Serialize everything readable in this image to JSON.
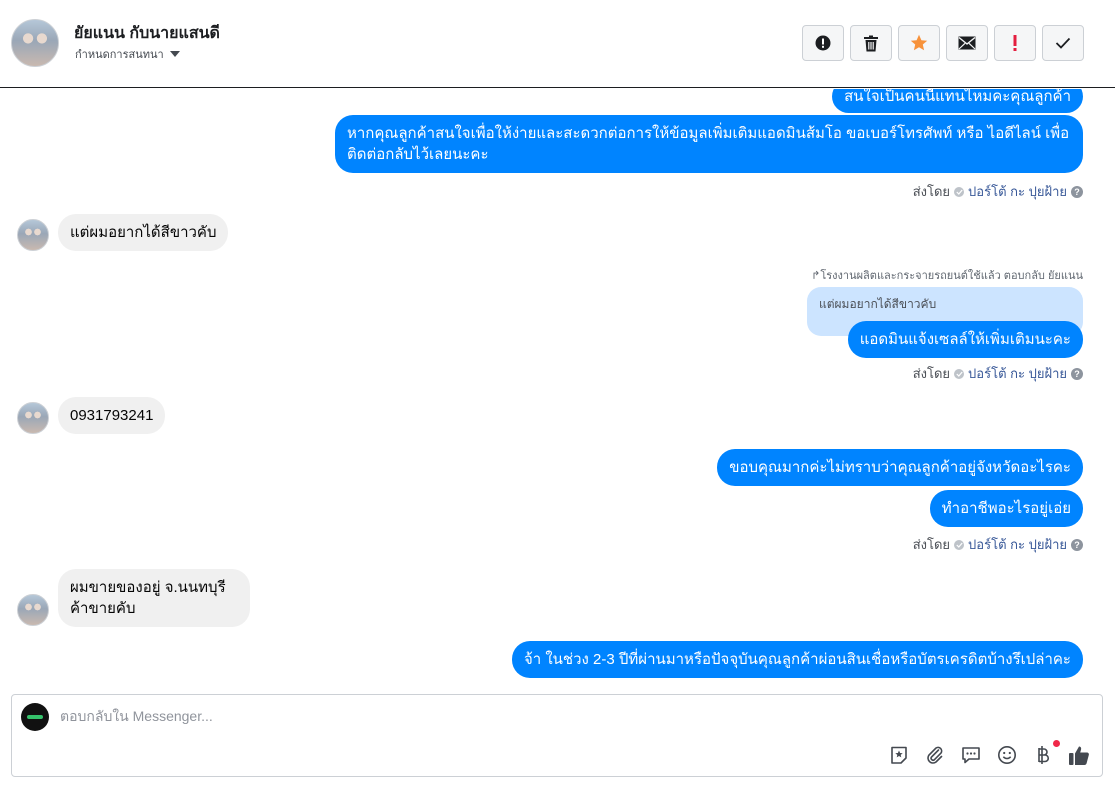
{
  "header": {
    "contact_name": "ยัยแนน กับนายแสนดี",
    "sub_label": "กำหนดการสนทนา",
    "actions": [
      {
        "name": "spam-icon",
        "label": "!"
      },
      {
        "name": "trash-icon",
        "label": "delete"
      },
      {
        "name": "star-icon",
        "label": "star"
      },
      {
        "name": "envelope-icon",
        "label": "unread"
      },
      {
        "name": "exclamation-icon",
        "label": "!"
      },
      {
        "name": "check-icon",
        "label": "done"
      }
    ],
    "colors": {
      "star": "#f7923b",
      "alert": "#e41e3f"
    }
  },
  "messages": {
    "m1": "สนใจเป็นคนนี้แทนไหมคะคุณลูกค้า",
    "m2": "หากคุณลูกค้าสนใจเพื่อให้ง่ายและสะดวกต่อการให้ข้อมูลเพิ่มเติมแอดมินส้มโอ ขอเบอร์โทรศัพท์ หรือ ไอดีไลน์ เพื่อติดต่อกลับไว้เลยนะคะ",
    "m3": "แต่ผมอยากได้สีขาวคับ",
    "reply_note": "↱โรงงานผลิตและกระจายรถยนต์ใช้แล้ว ตอบกลับ ยัยแนน",
    "quoted": "แต่ผมอยากได้สีขาวคับ",
    "m4": "แอดมินแจ้งเซลล์ให้เพิ่มเติมนะคะ",
    "m5": "0931793241",
    "m6": "ขอบคุณมากค่ะไม่ทราบว่าคุณลูกค้าอยู่จังหวัดอะไรคะ",
    "m7": "ทำอาชีพอะไรอยู่เอ่ย",
    "m8": "ผมขายของอยู่ จ.นนทบุรี ค้าขายคับ",
    "m9": "จ้า ในช่วง 2-3 ปีที่ผ่านมาหรือปัจจุบันคุณลูกค้าผ่อนสินเชื่อหรือบัตรเครดิตบ้างรึเปล่าคะ"
  },
  "sent_by": {
    "prefix": "ส่งโดย",
    "name": "ปอร์โต้ กะ ปุยฝ้าย",
    "help": "?"
  },
  "composer": {
    "placeholder": "ตอบกลับใน Messenger...",
    "tools": [
      "sticker-icon",
      "attachment-icon",
      "saved-replies-icon",
      "emoji-icon",
      "payment-icon",
      "like-icon"
    ]
  },
  "colors": {
    "outgoing": "#0084ff",
    "incoming": "#f0f0f0"
  }
}
